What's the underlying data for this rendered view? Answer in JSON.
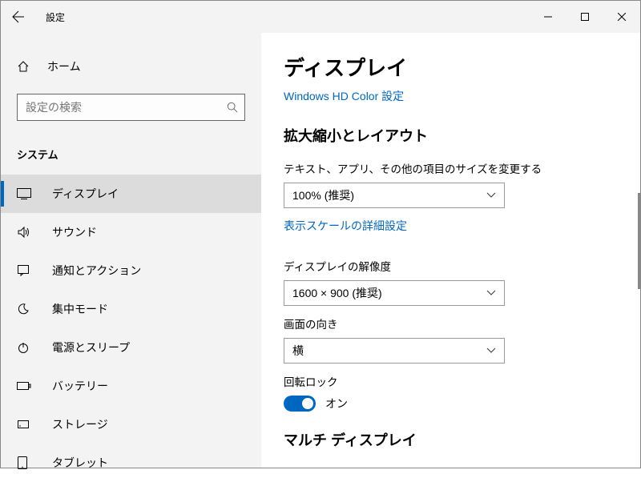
{
  "window": {
    "title": "設定"
  },
  "sidebar": {
    "home_label": "ホーム",
    "search_placeholder": "設定の検索",
    "category_label": "システム",
    "items": [
      {
        "label": "ディスプレイ",
        "selected": true
      },
      {
        "label": "サウンド",
        "selected": false
      },
      {
        "label": "通知とアクション",
        "selected": false
      },
      {
        "label": "集中モード",
        "selected": false
      },
      {
        "label": "電源とスリープ",
        "selected": false
      },
      {
        "label": "バッテリー",
        "selected": false
      },
      {
        "label": "ストレージ",
        "selected": false
      },
      {
        "label": "タブレット",
        "selected": false
      }
    ]
  },
  "main": {
    "page_title": "ディスプレイ",
    "hd_color_link": "Windows HD Color 設定",
    "section_scale_title": "拡大縮小とレイアウト",
    "scale_label": "テキスト、アプリ、その他の項目のサイズを変更する",
    "scale_value": "100% (推奨)",
    "advanced_scale_link": "表示スケールの詳細設定",
    "resolution_label": "ディスプレイの解像度",
    "resolution_value": "1600 × 900 (推奨)",
    "orientation_label": "画面の向き",
    "orientation_value": "横",
    "rotation_lock_label": "回転ロック",
    "rotation_lock_value": "オン",
    "section_multi_title": "マルチ ディスプレイ"
  }
}
